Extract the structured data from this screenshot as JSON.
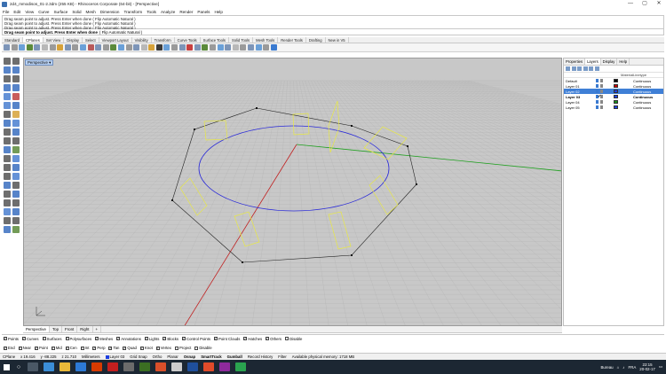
{
  "window": {
    "title": "2d4_mmodisos_01-2.3dm (255 KB) - Rhinoceros Corporate (64-bit) - [Perspective]",
    "controls": [
      "—",
      "▢",
      "✕"
    ]
  },
  "menu": [
    "File",
    "Edit",
    "View",
    "Curve",
    "Surface",
    "Solid",
    "Mesh",
    "Dimension",
    "Transform",
    "Tools",
    "Analyze",
    "Render",
    "Panels",
    "Help"
  ],
  "command_history": [
    "Drag seam point to adjust. Press Enter when done ( Flip  Automatic  Natural )",
    "Drag seam point to adjust. Press Enter when done ( Flip  Automatic  Natural )",
    "Drag seam point to adjust. Press Enter when done ( Flip  Automatic  Natural )"
  ],
  "command_prompt": {
    "prompt": "Drag seam point to adjust. Press Enter when done",
    "options": "( Flip  Automatic  Natural )"
  },
  "toolbar_tabs": [
    "Standard",
    "CPlanes",
    "Set View",
    "Display",
    "Select",
    "Viewport Layout",
    "Visibility",
    "Transform",
    "Curve Tools",
    "Surface Tools",
    "Solid Tools",
    "Mesh Tools",
    "Render Tools",
    "Drafting",
    "New in V5"
  ],
  "active_toolbar_tab": "CPlanes",
  "viewport": {
    "label": "Perspective ▾",
    "tabs": [
      "Perspective",
      "Top",
      "Front",
      "Right",
      "+"
    ],
    "active_tab": "Perspective"
  },
  "panel": {
    "tabs": [
      "Properties",
      "Layers",
      "Display",
      "Help"
    ],
    "active_tab": "Layers",
    "headers": {
      "name": "",
      "material": "Material",
      "linetype": "Linetype"
    },
    "layers": [
      {
        "name": "Default",
        "color": "#000000",
        "linetype": "Continuous",
        "selected": false,
        "current": false
      },
      {
        "name": "Layer 01",
        "color": "#cc0000",
        "linetype": "Continuous",
        "selected": false,
        "current": false
      },
      {
        "name": "Layer 02",
        "color": "#1c3fe0",
        "linetype": "Continuous",
        "selected": true,
        "current": false
      },
      {
        "name": "Layer 03",
        "color": "#1c3fe0",
        "linetype": "Continuous",
        "selected": false,
        "current": true
      },
      {
        "name": "Layer 04",
        "color": "#1a8f1a",
        "linetype": "Continuous",
        "selected": false,
        "current": false
      },
      {
        "name": "Layer 05",
        "color": "#1c3fe0",
        "linetype": "Continuous",
        "selected": false,
        "current": false
      }
    ],
    "current_mark": "✓"
  },
  "object_filters": [
    {
      "label": "Points",
      "checked": true
    },
    {
      "label": "Curves",
      "checked": true
    },
    {
      "label": "Surfaces",
      "checked": true
    },
    {
      "label": "Polysurfaces",
      "checked": true
    },
    {
      "label": "Meshes",
      "checked": true
    },
    {
      "label": "Annotations",
      "checked": true
    },
    {
      "label": "Lights",
      "checked": true
    },
    {
      "label": "Blocks",
      "checked": true
    },
    {
      "label": "Control Points",
      "checked": true
    },
    {
      "label": "Point Clouds",
      "checked": true
    },
    {
      "label": "Hatches",
      "checked": true
    },
    {
      "label": "Others",
      "checked": true
    },
    {
      "label": "Disable",
      "checked": false
    }
  ],
  "osnaps": [
    {
      "label": "End",
      "checked": true
    },
    {
      "label": "Near",
      "checked": true
    },
    {
      "label": "Point",
      "checked": true
    },
    {
      "label": "Mid",
      "checked": true
    },
    {
      "label": "Cen",
      "checked": true
    },
    {
      "label": "Int",
      "checked": true
    },
    {
      "label": "Perp",
      "checked": true
    },
    {
      "label": "Tan",
      "checked": true
    },
    {
      "label": "Quad",
      "checked": true
    },
    {
      "label": "Knot",
      "checked": true
    },
    {
      "label": "Vertex",
      "checked": true
    },
    {
      "label": "Project",
      "checked": false
    },
    {
      "label": "Disable",
      "checked": false
    }
  ],
  "status": {
    "cplane": "CPlane",
    "x": "x 19.416",
    "y": "y -88.225",
    "z": "z 21.710",
    "units": "Millimeters",
    "layer": "Layer 03",
    "modes": [
      "Grid Snap",
      "Ortho",
      "Planar",
      "Osnap",
      "SmartTrack",
      "Gumball",
      "Record History",
      "Filter"
    ],
    "bold_modes": [
      "Osnap",
      "SmartTrack",
      "Gumball"
    ],
    "memory": "Available physical memory: 1718 MB"
  },
  "taskbar": {
    "tray_label": "Bureau",
    "language": "FRA",
    "time": "22:15",
    "date": "20-02-17"
  },
  "colors": {
    "viewport_bg": "#c8c8c8",
    "grid": "#b4b4b4",
    "circle": "#2a2ad8",
    "fins": "#e8e845",
    "polygon": "#222222",
    "x_axis": "#c02020",
    "y_axis": "#20a020"
  }
}
